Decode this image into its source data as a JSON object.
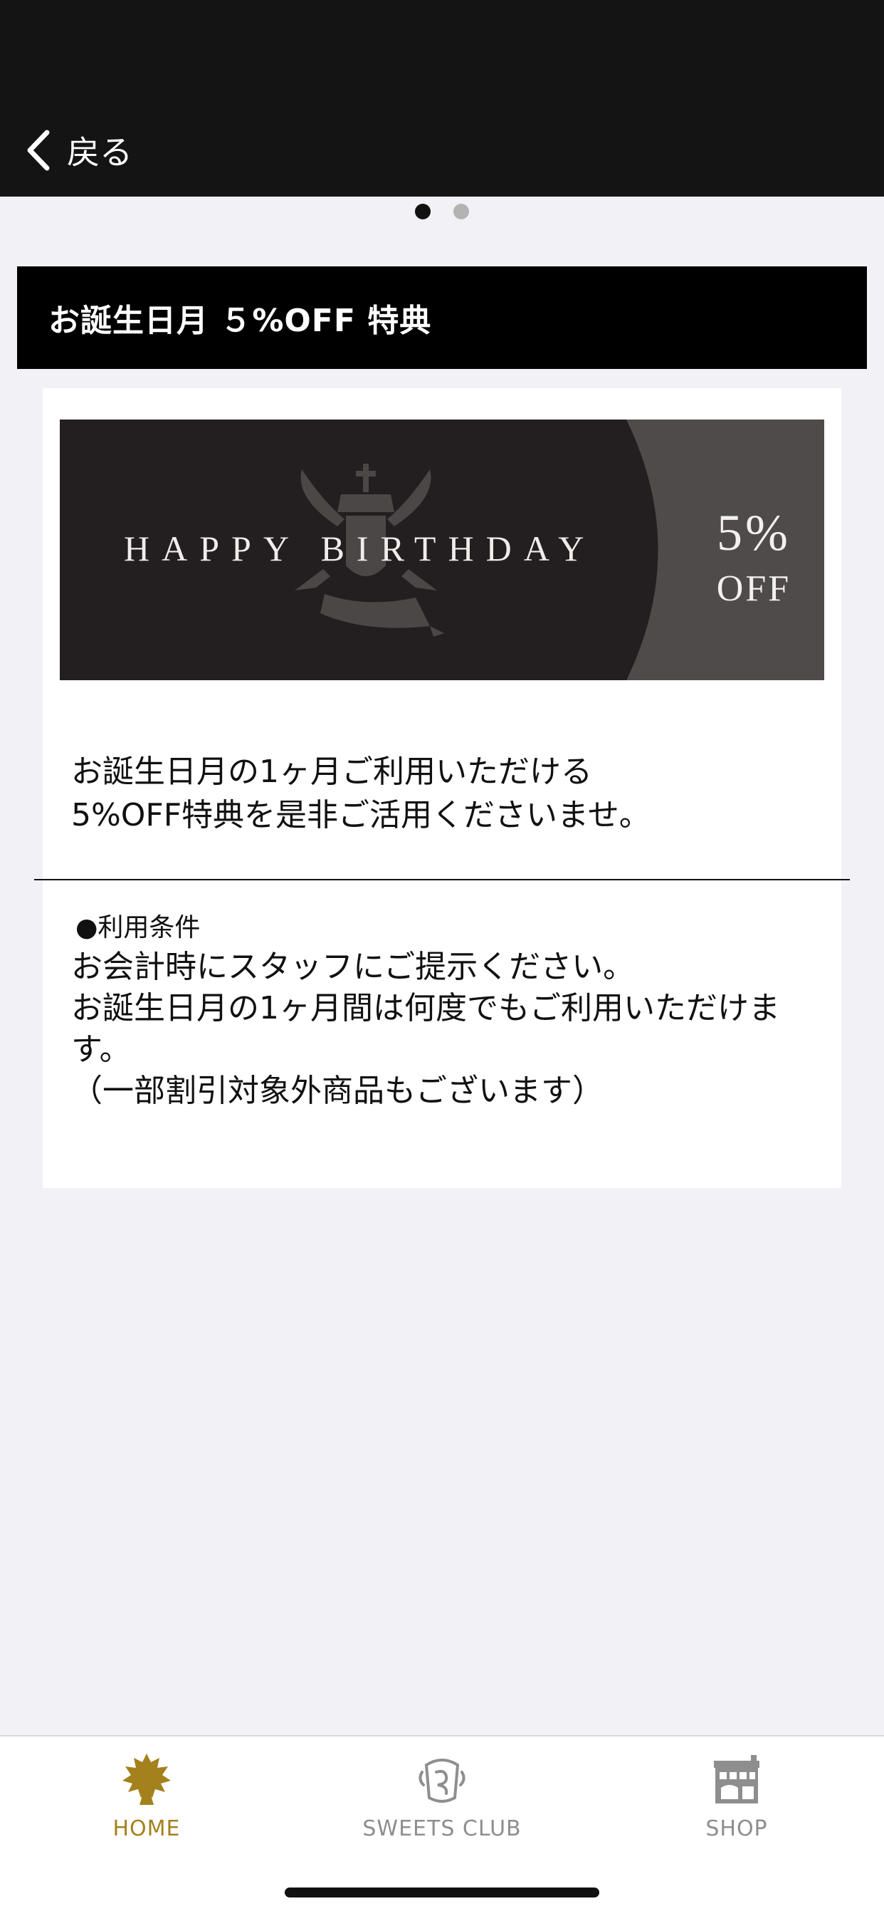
{
  "header": {
    "back_label": "戻る"
  },
  "pager": {
    "count": 2,
    "active_index": 0
  },
  "section": {
    "title": "お誕生日月 ５%OFF 特典"
  },
  "banner": {
    "happy_birthday": "HAPPY BIRTHDAY",
    "percent": "5%",
    "off": "OFF"
  },
  "description": {
    "line1": "お誕生日月の1ヶ月ご利用いただける",
    "line2": "5%OFF特典を是非ご活用くださいませ。"
  },
  "conditions": {
    "heading": "●利用条件",
    "body": "お会計時にスタッフにご提示ください。\nお誕生日月の1ヶ月間は何度でもご利用いただけます。\n（一部割引対象外商品もございます）"
  },
  "tabbar": {
    "items": [
      {
        "label": "HOME",
        "icon": "home-crest-icon",
        "active": true
      },
      {
        "label": "SWEETS CLUB",
        "icon": "sweets-club-icon",
        "active": false
      },
      {
        "label": "SHOP",
        "icon": "shop-icon",
        "active": false
      }
    ]
  },
  "colors": {
    "header_bg": "#141414",
    "accent_gold": "#a4811c",
    "inactive_tab": "#8e8e8e"
  }
}
